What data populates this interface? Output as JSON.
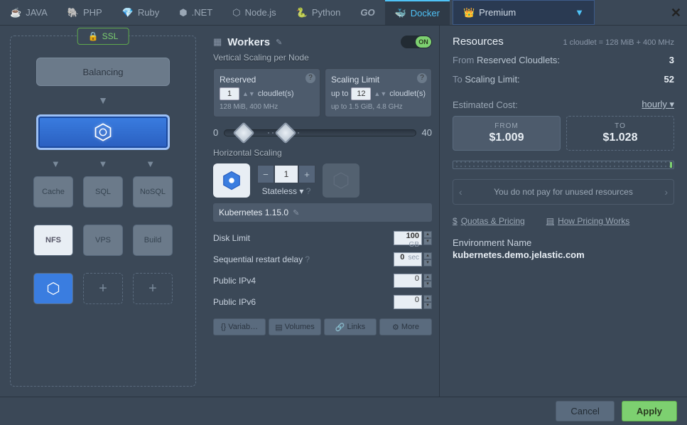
{
  "tabs": {
    "java": "JAVA",
    "php": "PHP",
    "ruby": "Ruby",
    "dotnet": ".NET",
    "node": "Node.js",
    "python": "Python",
    "go": "GO",
    "docker": "Docker"
  },
  "premium": {
    "label": "Premium"
  },
  "ssl": {
    "label": "SSL"
  },
  "topology": {
    "balancing": "Balancing",
    "cache": "Cache",
    "sql": "SQL",
    "nosql": "NoSQL",
    "nfs": "NFS",
    "vps": "VPS",
    "build": "Build"
  },
  "workers": {
    "title": "Workers",
    "toggle": "ON",
    "vertical_label": "Vertical Scaling per Node",
    "reserved": {
      "title": "Reserved",
      "value": "1",
      "unit": "cloudlet(s)",
      "detail": "128 MiB, 400 MHz"
    },
    "limit": {
      "title": "Scaling Limit",
      "prefix": "up to",
      "value": "12",
      "unit": "cloudlet(s)",
      "detail_prefix": "up to",
      "detail": "1.5 GiB, 4.8 GHz"
    },
    "slider": {
      "min": "0",
      "max": "40"
    },
    "horizontal_label": "Horizontal Scaling",
    "count": "1",
    "mode": "Stateless",
    "version": "Kubernetes 1.15.0",
    "disk": {
      "label": "Disk Limit",
      "value": "100",
      "unit": "GB"
    },
    "restart": {
      "label": "Sequential restart delay",
      "value": "0",
      "unit": "sec"
    },
    "ipv4": {
      "label": "Public IPv4",
      "value": "0"
    },
    "ipv6": {
      "label": "Public IPv6",
      "value": "0"
    },
    "buttons": {
      "vars": "Variab…",
      "vols": "Volumes",
      "links": "Links",
      "more": "More"
    }
  },
  "resources": {
    "title": "Resources",
    "ratio": "1 cloudlet = 128 MiB + 400 MHz",
    "from_label": "From",
    "reserved_label": "Reserved Cloudlets:",
    "reserved_val": "3",
    "to_label": "To",
    "limit_label": "Scaling Limit:",
    "limit_val": "52",
    "cost_label": "Estimated Cost:",
    "period": "hourly",
    "from_cost": {
      "label": "FROM",
      "value": "$1.009"
    },
    "to_cost": {
      "label": "TO",
      "value": "$1.028"
    },
    "info": "You do not pay for unused resources",
    "quotas": "Quotas & Pricing",
    "how": "How Pricing Works",
    "env_label": "Environment Name",
    "env_name": "kubernetes.demo.jelastic.com"
  },
  "footer": {
    "cancel": "Cancel",
    "apply": "Apply"
  }
}
